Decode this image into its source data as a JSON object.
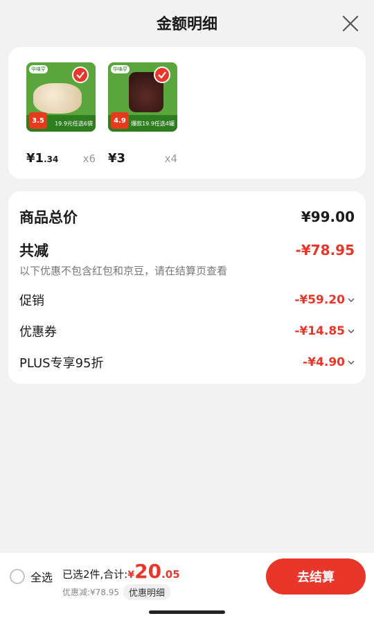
{
  "header": {
    "title": "金额明细"
  },
  "products": [
    {
      "brand": "华味亨",
      "tag": "3.5",
      "banner": "19.9元任选6袋",
      "price_int": "¥1",
      "price_dec": ".34",
      "qty": "x6"
    },
    {
      "brand": "华味亨",
      "tag": "4.9",
      "banner": "爆款19.9任选4罐",
      "price_int": "¥3",
      "price_dec": "",
      "qty": "x4"
    }
  ],
  "summary": {
    "total_label": "商品总价",
    "total_value": "¥99.00",
    "reduce_label": "共减",
    "reduce_value": "-¥78.95",
    "note": "以下优惠不包含红包和京豆，请在结算页查看",
    "items": [
      {
        "label": "促销",
        "value": "-¥59.20"
      },
      {
        "label": "优惠券",
        "value": "-¥14.85"
      },
      {
        "label": "PLUS专享95折",
        "value": "-¥4.90"
      }
    ]
  },
  "footer": {
    "select_all": "全选",
    "total_label": "已选2件,合计:",
    "total_yen": "¥",
    "total_int": "20",
    "total_dec": ".05",
    "discount_text": "优惠减:¥78.95",
    "detail_btn": "优惠明细",
    "checkout": "去结算"
  },
  "colors": {
    "accent": "#e8362a",
    "background": "#f2f2f2"
  }
}
